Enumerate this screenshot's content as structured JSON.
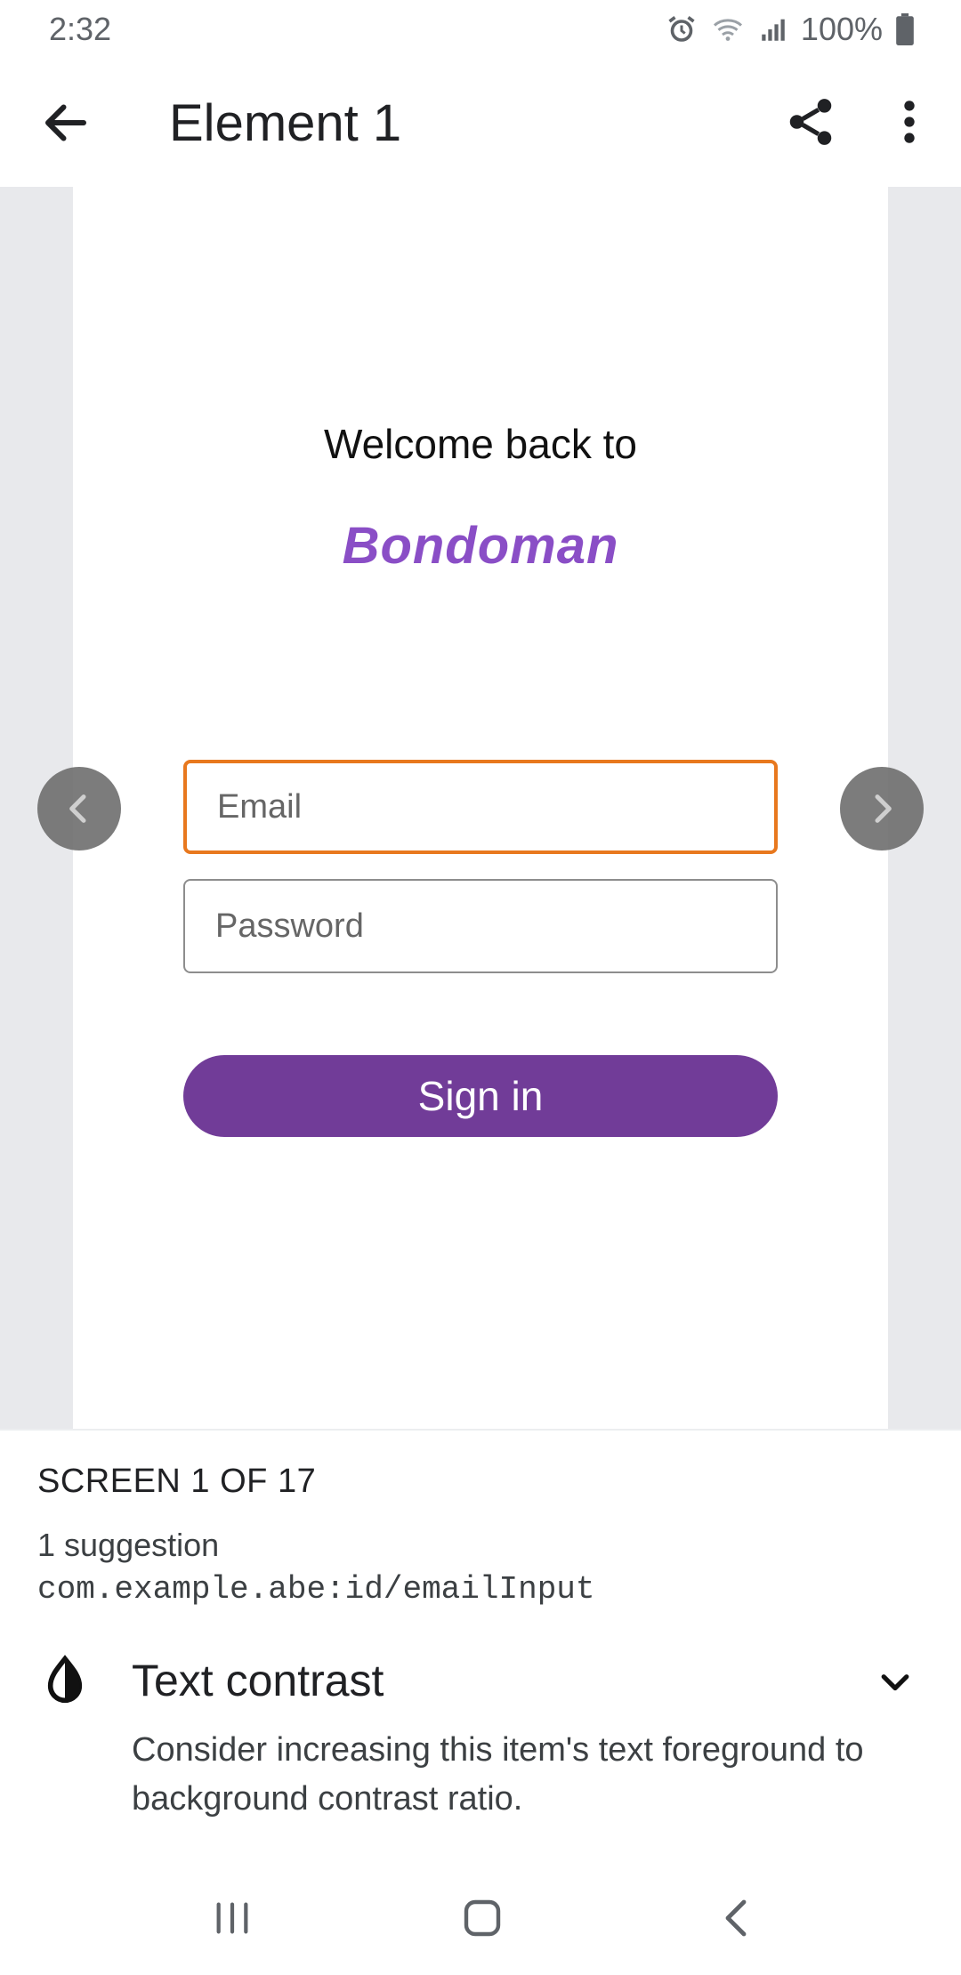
{
  "status_bar": {
    "time": "2:32",
    "battery": "100%",
    "icons": [
      "alarm-icon",
      "wifi-icon",
      "signal-icon",
      "battery-icon"
    ]
  },
  "app_bar": {
    "title": "Element 1",
    "icons": [
      "back-arrow-icon",
      "share-icon",
      "more-vert-icon"
    ]
  },
  "preview": {
    "welcome_text": "Welcome back to",
    "brand_name": "Bondoman",
    "email_placeholder": "Email",
    "password_placeholder": "Password",
    "signin_label": "Sign in",
    "colors": {
      "brand": "#8a4ec6",
      "button": "#713c98",
      "highlight": "#e8781e"
    }
  },
  "carousel": {
    "prev_icon": "chevron-left-icon",
    "next_icon": "chevron-right-icon"
  },
  "results": {
    "screen_counter": "SCREEN 1 OF 17",
    "suggestion_count": "1 suggestion",
    "element_id": "com.example.abe:id/emailInput",
    "issue": {
      "title": "Text contrast",
      "description": "Consider increasing this item's text foreground to background contrast ratio.",
      "icon": "contrast-icon"
    }
  },
  "nav_bar": {
    "icons": [
      "recent-apps-icon",
      "home-icon",
      "back-icon"
    ]
  }
}
